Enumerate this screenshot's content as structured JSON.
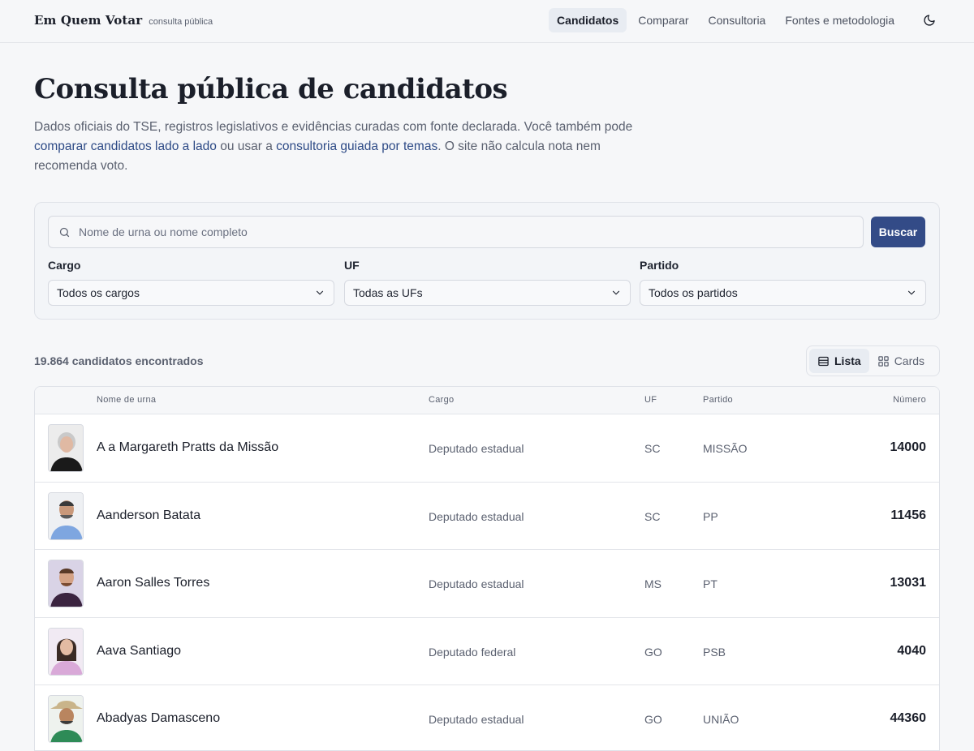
{
  "brand": {
    "name": "Em Quem Votar",
    "subtitle": "consulta pública"
  },
  "nav": {
    "items": [
      {
        "label": "Candidatos",
        "active": true
      },
      {
        "label": "Comparar",
        "active": false
      },
      {
        "label": "Consultoria",
        "active": false
      },
      {
        "label": "Fontes e metodologia",
        "active": false
      }
    ],
    "theme_icon": "moon-icon"
  },
  "hero": {
    "title": "Consulta pública de candidatos",
    "intro_part1": "Dados oficiais do TSE, registros legislativos e evidências curadas com fonte declarada. Você também pode ",
    "link_compare": "comparar candidatos lado a lado",
    "intro_part2": " ou usar a ",
    "link_consult": "consultoria guiada por temas",
    "intro_part3": ". O site não calcula nota nem recomenda voto."
  },
  "search": {
    "placeholder": "Nome de urna ou nome completo",
    "value": "",
    "button_label": "Buscar"
  },
  "filters": {
    "cargo": {
      "label": "Cargo",
      "selected": "Todos os cargos"
    },
    "uf": {
      "label": "UF",
      "selected": "Todas as UFs"
    },
    "partido": {
      "label": "Partido",
      "selected": "Todos os partidos"
    }
  },
  "results": {
    "count_text": "19.864 candidatos encontrados",
    "view_list_label": "Lista",
    "view_cards_label": "Cards",
    "active_view": "Lista"
  },
  "table": {
    "columns": {
      "nome": "Nome de urna",
      "cargo": "Cargo",
      "uf": "UF",
      "partido": "Partido",
      "numero": "Número"
    },
    "rows": [
      {
        "nome": "A a Margareth Pratts da Missão",
        "cargo": "Deputado estadual",
        "uf": "SC",
        "partido": "MISSÃO",
        "numero": "14000"
      },
      {
        "nome": "Aanderson Batata",
        "cargo": "Deputado estadual",
        "uf": "SC",
        "partido": "PP",
        "numero": "11456"
      },
      {
        "nome": "Aaron Salles Torres",
        "cargo": "Deputado estadual",
        "uf": "MS",
        "partido": "PT",
        "numero": "13031"
      },
      {
        "nome": "Aava Santiago",
        "cargo": "Deputado federal",
        "uf": "GO",
        "partido": "PSB",
        "numero": "4040"
      },
      {
        "nome": "Abadyas Damasceno",
        "cargo": "Deputado estadual",
        "uf": "GO",
        "partido": "UNIÃO",
        "numero": "44360"
      }
    ]
  },
  "colors": {
    "primary": "#334b87",
    "link": "#2d4a86",
    "background": "#f6f7f9"
  }
}
